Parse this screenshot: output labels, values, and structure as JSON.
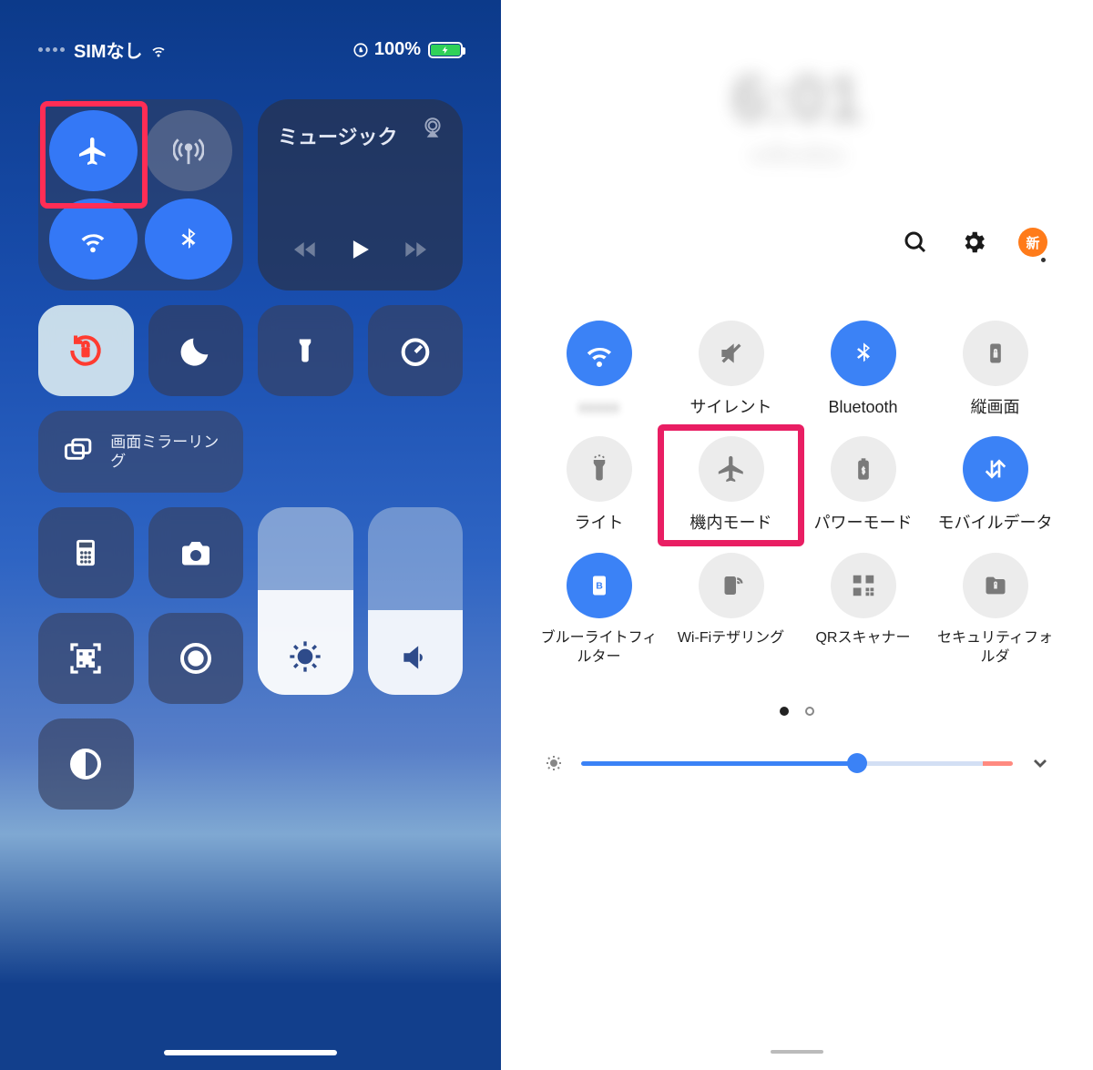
{
  "ios": {
    "status": {
      "carrier": "SIMなし",
      "battery_pct": "100%"
    },
    "music": {
      "title": "ミュージック"
    },
    "mirror": {
      "label": "画面ミラーリング"
    }
  },
  "android": {
    "clock": {
      "time": "6:01",
      "date": "xx月xx日(x)"
    },
    "badge": "新",
    "tiles": {
      "wifi": "",
      "silent": "サイレント",
      "bluetooth": "Bluetooth",
      "orientation": "縦画面",
      "light": "ライト",
      "airplane": "機内モード",
      "power": "パワーモード",
      "mobile": "モバイルデータ",
      "bluelight": "ブルーライトフィルター",
      "tether": "Wi-Fiテザリング",
      "qr": "QRスキャナー",
      "secure": "セキュリティフォルダ"
    }
  }
}
